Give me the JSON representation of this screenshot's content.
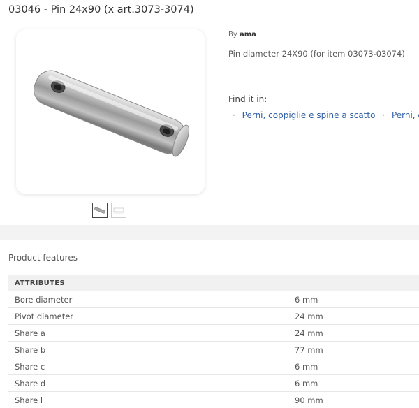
{
  "product": {
    "title": "03046 - Pin 24x90 (x art.3073-3074)",
    "by_label": "By",
    "brand": "ama",
    "description": "Pin diameter 24X90 (for item 03073-03074)"
  },
  "find_it_in": {
    "label": "Find it in:",
    "separator": "·",
    "links": [
      "Perni, coppiglie e spine a scatto",
      "Perni, copp"
    ]
  },
  "features": {
    "section_title": "Product features",
    "header": "ATTRIBUTES",
    "rows": [
      {
        "name": "Bore diameter",
        "value": "6 mm"
      },
      {
        "name": "Pivot diameter",
        "value": "24 mm"
      },
      {
        "name": "Share a",
        "value": "24 mm"
      },
      {
        "name": "Share b",
        "value": "77 mm"
      },
      {
        "name": "Share c",
        "value": "6 mm"
      },
      {
        "name": "Share d",
        "value": "6 mm"
      },
      {
        "name": "Share l",
        "value": "90 mm"
      }
    ]
  },
  "colors": {
    "link": "#2f5fa5",
    "header_bg": "#f1f1f1",
    "band_bg": "#f3f3f3"
  },
  "gallery": {
    "thumbnail_count": 2,
    "active_thumbnail": 1
  }
}
